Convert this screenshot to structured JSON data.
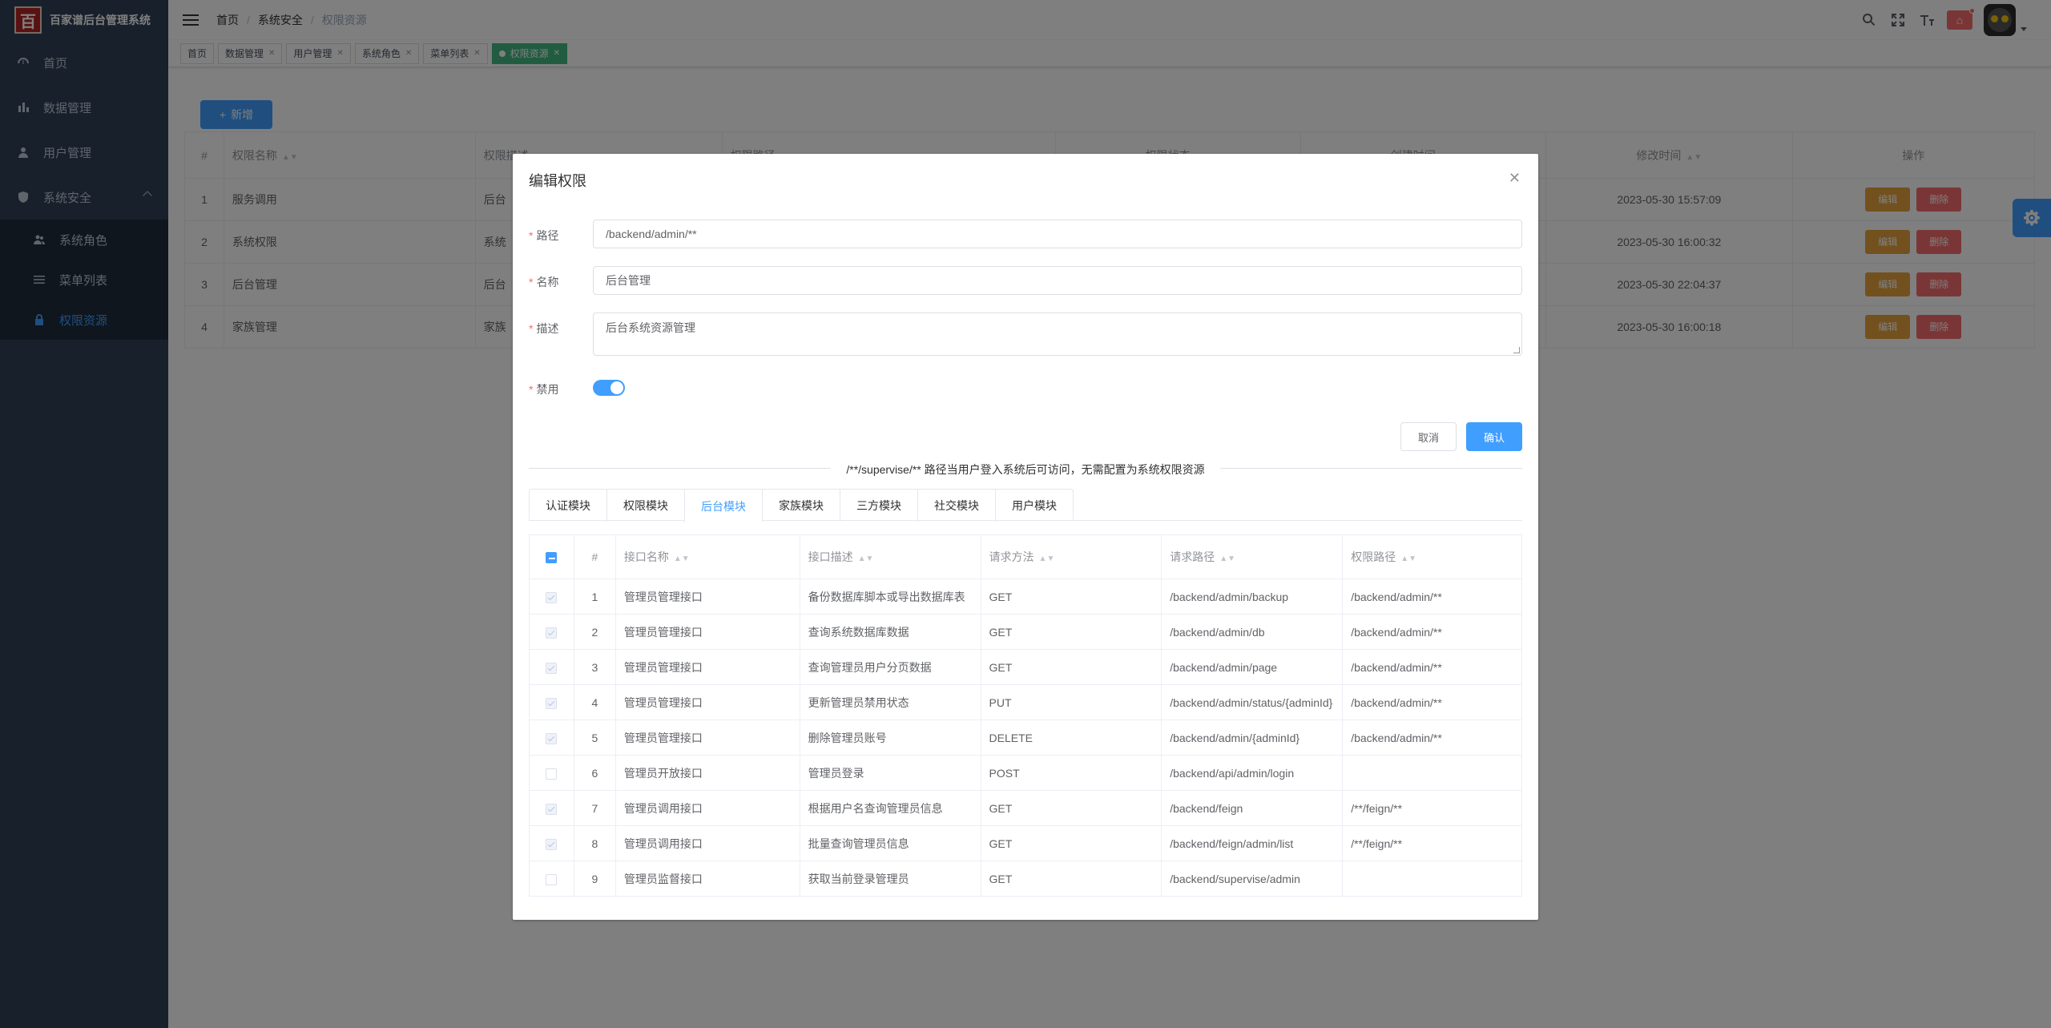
{
  "app": {
    "title": "百家谱后台管理系统",
    "logo_text": "百"
  },
  "sidebar": {
    "items": [
      {
        "label": "首页",
        "icon": "dashboard-icon"
      },
      {
        "label": "数据管理",
        "icon": "chart-icon"
      },
      {
        "label": "用户管理",
        "icon": "user-icon"
      },
      {
        "label": "系统安全",
        "icon": "shield-icon"
      }
    ],
    "subitems": [
      {
        "label": "系统角色",
        "icon": "peoples-icon"
      },
      {
        "label": "菜单列表",
        "icon": "list-icon"
      },
      {
        "label": "权限资源",
        "icon": "lock-icon",
        "active": true
      }
    ]
  },
  "breadcrumb": [
    "首页",
    "系统安全",
    "权限资源"
  ],
  "tags": [
    {
      "label": "首页"
    },
    {
      "label": "数据管理"
    },
    {
      "label": "用户管理"
    },
    {
      "label": "系统角色"
    },
    {
      "label": "菜单列表"
    },
    {
      "label": "权限资源",
      "active": true
    }
  ],
  "main": {
    "add_button": "新增",
    "columns": [
      "#",
      "权限名称",
      "权限描述",
      "权限路径",
      "权限状态",
      "创建时间",
      "修改时间",
      "操作"
    ],
    "rows": [
      {
        "idx": "1",
        "name": "服务调用",
        "desc": "后台",
        "modified": "2023-05-30 15:57:09"
      },
      {
        "idx": "2",
        "name": "系统权限",
        "desc": "系统",
        "modified": "2023-05-30 16:00:32"
      },
      {
        "idx": "3",
        "name": "后台管理",
        "desc": "后台",
        "modified": "2023-05-30 22:04:37"
      },
      {
        "idx": "4",
        "name": "家族管理",
        "desc": "家族",
        "modified": "2023-05-30 16:00:18"
      }
    ],
    "edit_label": "编辑",
    "delete_label": "删除"
  },
  "dialog": {
    "title": "编辑权限",
    "path_label": "路径",
    "path_value": "/backend/admin/**",
    "name_label": "名称",
    "name_value": "后台管理",
    "desc_label": "描述",
    "desc_value": "后台系统资源管理",
    "disabled_label": "禁用",
    "disabled_on": true,
    "cancel": "取消",
    "confirm": "确认",
    "divider_text": "/**/supervise/** 路径当用户登入系统后可访问，无需配置为系统权限资源",
    "tabs": [
      "认证模块",
      "权限模块",
      "后台模块",
      "家族模块",
      "三方模块",
      "社交模块",
      "用户模块"
    ],
    "active_tab": "后台模块",
    "api_columns": [
      "#",
      "接口名称",
      "接口描述",
      "请求方法",
      "请求路径",
      "权限路径"
    ],
    "api_rows": [
      {
        "checked": true,
        "idx": "1",
        "name": "管理员管理接口",
        "desc": "备份数据库脚本或导出数据库表",
        "method": "GET",
        "path": "/backend/admin/backup",
        "perm": "/backend/admin/**"
      },
      {
        "checked": true,
        "idx": "2",
        "name": "管理员管理接口",
        "desc": "查询系统数据库数据",
        "method": "GET",
        "path": "/backend/admin/db",
        "perm": "/backend/admin/**"
      },
      {
        "checked": true,
        "idx": "3",
        "name": "管理员管理接口",
        "desc": "查询管理员用户分页数据",
        "method": "GET",
        "path": "/backend/admin/page",
        "perm": "/backend/admin/**"
      },
      {
        "checked": true,
        "idx": "4",
        "name": "管理员管理接口",
        "desc": "更新管理员禁用状态",
        "method": "PUT",
        "path": "/backend/admin/status/{adminId}",
        "perm": "/backend/admin/**"
      },
      {
        "checked": true,
        "idx": "5",
        "name": "管理员管理接口",
        "desc": "删除管理员账号",
        "method": "DELETE",
        "path": "/backend/admin/{adminId}",
        "perm": "/backend/admin/**"
      },
      {
        "checked": false,
        "idx": "6",
        "name": "管理员开放接口",
        "desc": "管理员登录",
        "method": "POST",
        "path": "/backend/api/admin/login",
        "perm": ""
      },
      {
        "checked": true,
        "idx": "7",
        "name": "管理员调用接口",
        "desc": "根据用户名查询管理员信息",
        "method": "GET",
        "path": "/backend/feign",
        "perm": "/**/feign/**"
      },
      {
        "checked": true,
        "idx": "8",
        "name": "管理员调用接口",
        "desc": "批量查询管理员信息",
        "method": "GET",
        "path": "/backend/feign/admin/list",
        "perm": "/**/feign/**"
      },
      {
        "checked": false,
        "idx": "9",
        "name": "管理员监督接口",
        "desc": "获取当前登录管理员",
        "method": "GET",
        "path": "/backend/supervise/admin",
        "perm": ""
      }
    ]
  },
  "colors": {
    "primary": "#409eff",
    "sidebar_bg": "#304156",
    "tag_active": "#42b983",
    "warning": "#e6a23c",
    "danger": "#f56c6c"
  }
}
